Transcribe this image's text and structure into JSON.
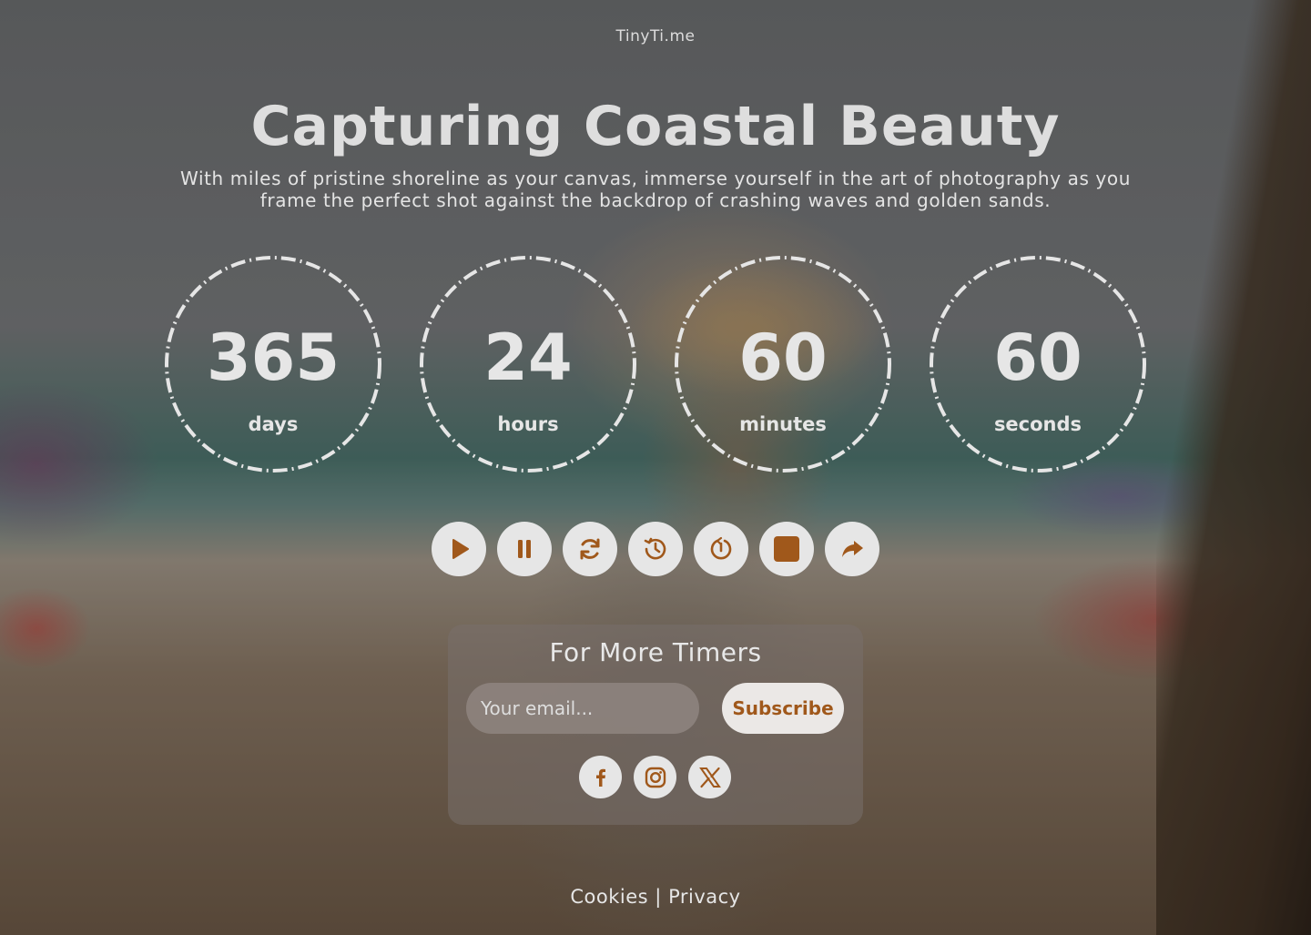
{
  "brand": "TinyTi.me",
  "title": "Capturing Coastal Beauty",
  "subtitle": "With miles of pristine shoreline as your canvas, immerse yourself in the art of photography as you frame the perfect shot against the backdrop of crashing waves and golden sands.",
  "timers": [
    {
      "value": "365",
      "label": "days"
    },
    {
      "value": "24",
      "label": "hours"
    },
    {
      "value": "60",
      "label": "minutes"
    },
    {
      "value": "60",
      "label": "seconds"
    }
  ],
  "controls": [
    "play-icon",
    "pause-icon",
    "refresh-icon",
    "history-icon",
    "restart-icon",
    "stop-icon",
    "share-icon"
  ],
  "subscribe_panel": {
    "heading": "For More Timers",
    "email_placeholder": "Your email...",
    "button_label": "Subscribe"
  },
  "socials": [
    "facebook-icon",
    "instagram-icon",
    "x-icon"
  ],
  "footer": {
    "cookies": "Cookies",
    "separator": "|",
    "privacy": "Privacy"
  },
  "colors": {
    "accent": "#a0581b",
    "button_bg": "#e6e6e6",
    "text": "#e6e6e6"
  }
}
